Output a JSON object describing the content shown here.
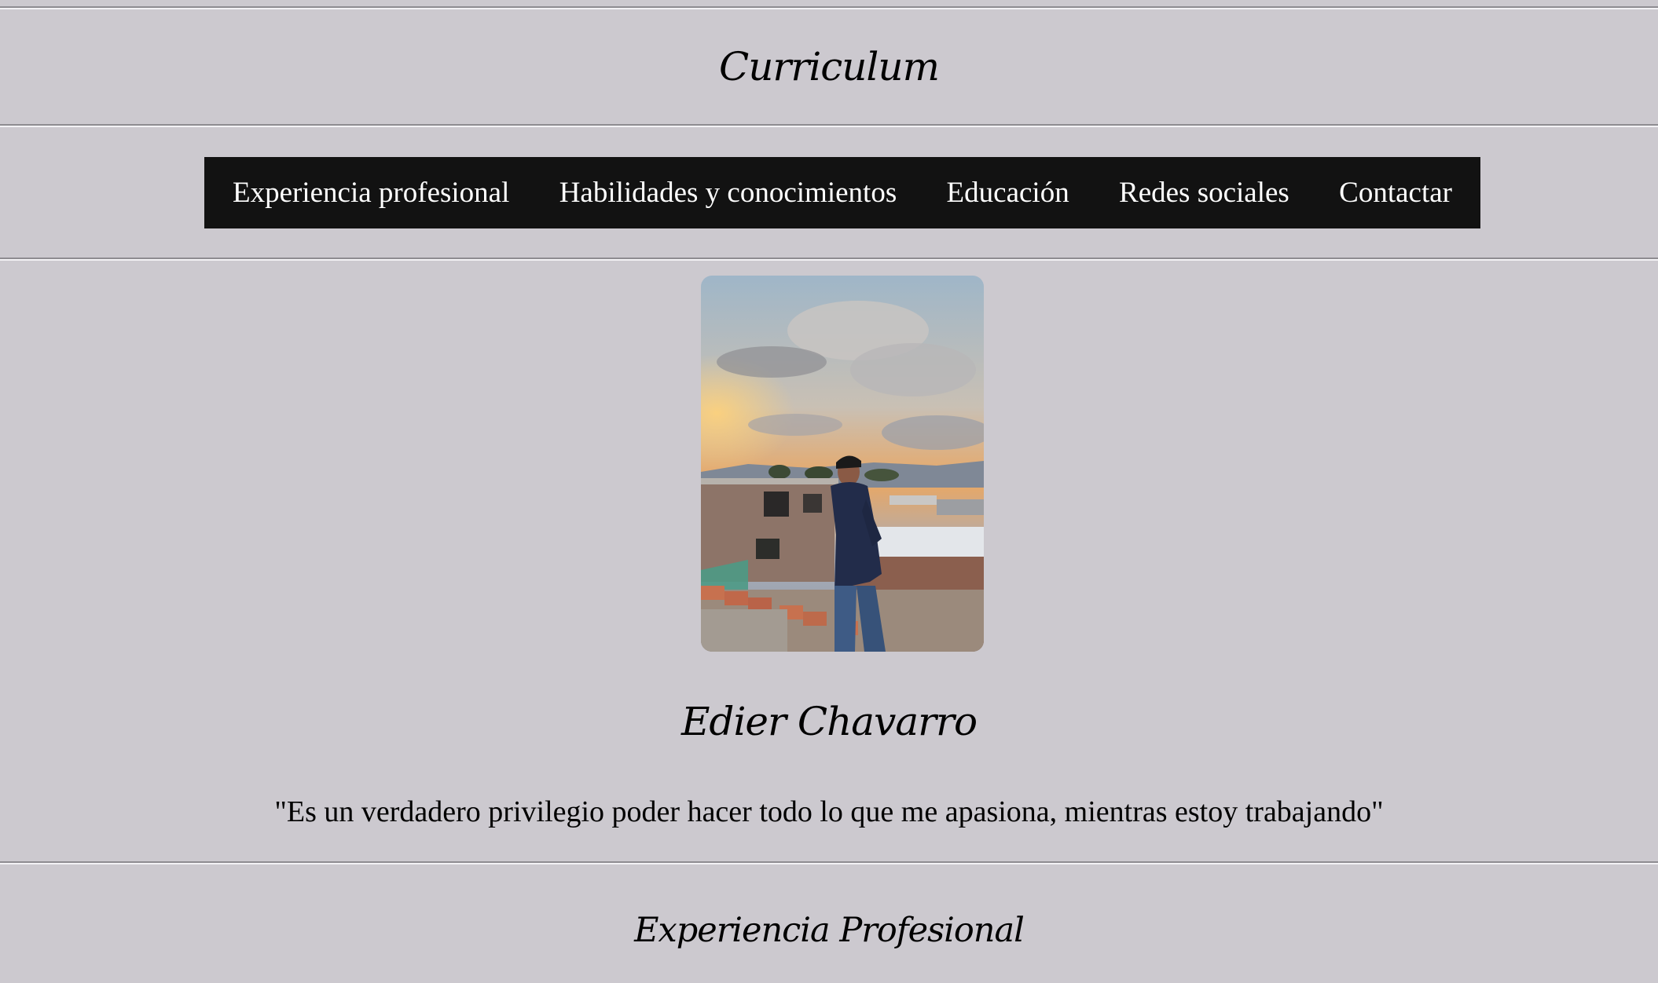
{
  "header": {
    "title": "Curriculum"
  },
  "nav": {
    "items": [
      {
        "label": "Experiencia profesional"
      },
      {
        "label": "Habilidades y conocimientos"
      },
      {
        "label": "Educación"
      },
      {
        "label": "Redes sociales"
      },
      {
        "label": "Contactar"
      }
    ]
  },
  "profile": {
    "photo_icon": "profile-photo",
    "name": "Edier Chavarro",
    "quote": "\"Es un verdadero privilegio poder hacer todo lo que me apasiona, mientras estoy trabajando\""
  },
  "sections": {
    "experience_title": "Experiencia Profesional"
  },
  "colors": {
    "background": "#ccc9cf",
    "nav_background": "#121212",
    "nav_text": "#ffffff"
  }
}
